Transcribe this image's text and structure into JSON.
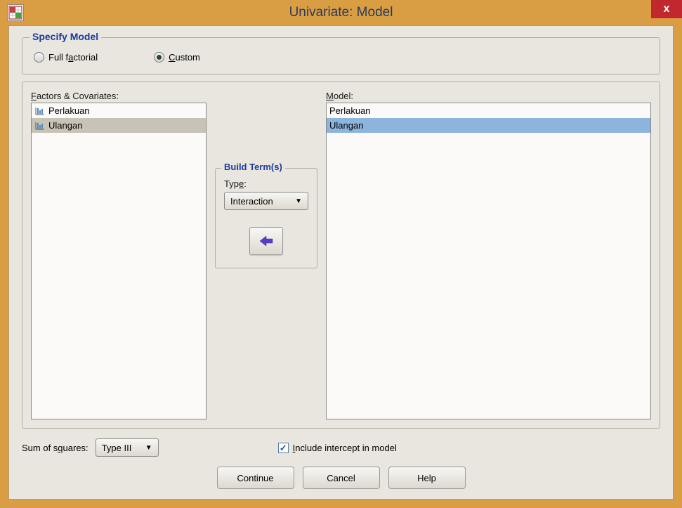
{
  "window": {
    "title": "Univariate: Model",
    "close_symbol": "x"
  },
  "specify_model": {
    "group_title": "Specify Model",
    "full_factorial_prefix": "Full f",
    "full_factorial_ul": "a",
    "full_factorial_suffix": "ctorial",
    "custom_ul": "C",
    "custom_suffix": "ustom",
    "selected": "custom"
  },
  "factors": {
    "label_ul": "F",
    "label_suffix": "actors & Covariates:",
    "items": [
      {
        "label": "Perlakuan",
        "selected": false
      },
      {
        "label": "Ulangan",
        "selected": true
      }
    ]
  },
  "build_terms": {
    "group_title": "Build Term(s)",
    "type_prefix": "Typ",
    "type_ul": "e",
    "type_suffix": ":",
    "type_value": "Interaction"
  },
  "model": {
    "label_ul": "M",
    "label_suffix": "odel:",
    "items": [
      {
        "label": "Perlakuan",
        "selected": false
      },
      {
        "label": "Ulangan",
        "selected": true
      }
    ]
  },
  "sum_of_squares": {
    "prefix": "Sum of s",
    "ul": "q",
    "suffix": "uares:",
    "value": "Type III"
  },
  "intercept": {
    "prefix": "",
    "ul": "I",
    "suffix": "nclude intercept in model",
    "checked": true
  },
  "buttons": {
    "continue": "Continue",
    "cancel": "Cancel",
    "help": "Help"
  }
}
